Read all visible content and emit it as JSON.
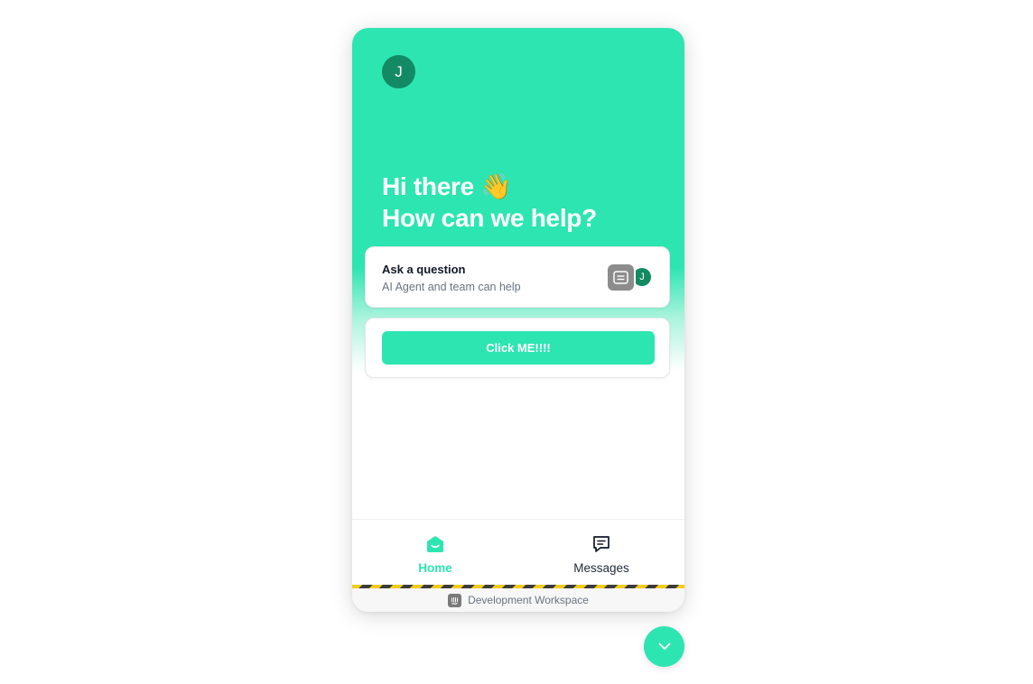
{
  "header": {
    "avatar_initial": "J",
    "greeting_line1": "Hi there 👋",
    "greeting_line2": "How can we help?"
  },
  "ask_card": {
    "title": "Ask a question",
    "subtitle": "AI Agent and team can help",
    "ai_avatar_icon": "bot-icon",
    "agent_avatar_initial": "J"
  },
  "cta": {
    "label": "Click ME!!!!"
  },
  "nav": {
    "items": [
      {
        "label": "Home",
        "icon": "home-icon",
        "active": true
      },
      {
        "label": "Messages",
        "icon": "messages-icon",
        "active": false
      }
    ]
  },
  "footer": {
    "workspace_label": "Development Workspace",
    "workspace_icon": "intercom-logo-icon"
  },
  "launcher": {
    "icon": "chevron-down-icon"
  },
  "colors": {
    "accent": "#2de5b1",
    "avatar": "#138a63",
    "ai_avatar": "#8c8c8c"
  }
}
